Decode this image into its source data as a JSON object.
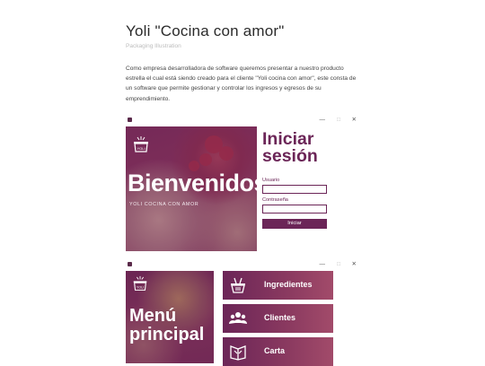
{
  "article": {
    "title": "Yoli \"Cocina con amor\"",
    "subtitle": "Packaging Illustration",
    "description": "Como empresa desarrolladora de software queremos presentar a nuestro producto estrella el cual está siendo creado para el cliente \"Yoli cocina con amor\", este consta de un software que permite gestionar y controlar los ingresos y egresos de su emprendimiento."
  },
  "window_controls": {
    "minimize": "—",
    "maximize": "□",
    "close": "✕"
  },
  "login": {
    "logo_text": "YOLI",
    "hero_title": "Bienvenidos",
    "hero_subtitle": "YOLI COCINA CON AMOR",
    "title_line1": "Iniciar",
    "title_line2": "sesión",
    "user_label": "Usuario",
    "password_label": "Contraseña",
    "user_value": "",
    "password_value": "",
    "button_label": "Iniciar"
  },
  "menu": {
    "logo_text": "YOLI",
    "title_line1": "Menú",
    "title_line2": "principal",
    "items": [
      {
        "label": "Ingredientes",
        "icon": "basket-icon"
      },
      {
        "label": "Clientes",
        "icon": "people-icon"
      },
      {
        "label": "Carta",
        "icon": "menu-card-icon"
      }
    ]
  },
  "colors": {
    "accent": "#6b2557",
    "text": "#2b2b2b",
    "muted": "#bdbdbd"
  }
}
